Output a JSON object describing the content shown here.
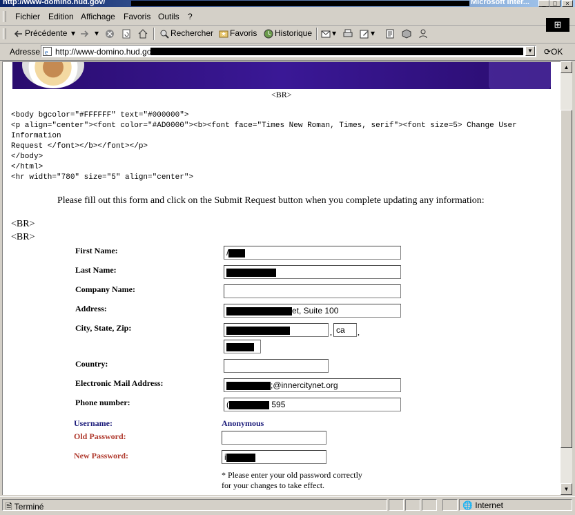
{
  "window": {
    "title_url": "http://www-domino.hud.gov/",
    "app_name": "Microsoft Inter..."
  },
  "menu": [
    {
      "label": "Fichier"
    },
    {
      "label": "Edition"
    },
    {
      "label": "Affichage"
    },
    {
      "label": "Favoris"
    },
    {
      "label": "Outils"
    },
    {
      "label": "?"
    }
  ],
  "toolbar": {
    "back_label": "Précédente",
    "search_label": "Rechercher",
    "favorites_label": "Favoris",
    "history_label": "Historique"
  },
  "address": {
    "label": "Adresse",
    "url": "http://www-domino.hud.gov.",
    "go_label": "OK"
  },
  "page": {
    "br_center": "<BR>",
    "source_lines": [
      "<body bgcolor=\"#FFFFFF\" text=\"#000000\">",
      "<p align=\"center\"><font color=\"#AD0000\"><b><font face=\"Times New Roman, Times, serif\"><font size=5> Change User",
      "Information",
      "Request </font></b></font></p>",
      "</body>",
      "</html>",
      "<hr width=\"780\" size=\"5\" align=\"center\">"
    ],
    "instructions": "Please fill out this form and click on the Submit Request button when you complete updating any information:",
    "br1": "<BR>",
    "br2": "<BR>"
  },
  "form": {
    "first_name_label": "First Name:",
    "first_name_value": "/",
    "last_name_label": "Last Name:",
    "company_label": "Company Name:",
    "company_value": "",
    "address_label": "Address:",
    "address_value": "et, Suite 100",
    "city_label": "City, State, Zip:",
    "state_value": "ca",
    "comma": ",",
    "country_label": "Country:",
    "country_value": "",
    "email_label": "Electronic Mail Address:",
    "email_value": ";@innercitynet.org",
    "phone_label": "Phone number:",
    "phone_prefix": "(",
    "phone_value": "595",
    "username_label": "Username:",
    "username_value": "Anonymous",
    "old_password_label": "Old Password:",
    "old_password_value": "",
    "new_password_label": "New Password:",
    "new_password_prefix": "i",
    "note_line1": "* Please enter your old password correctly",
    "note_line2": "for your changes to take effect."
  },
  "status": {
    "text": "Terminé",
    "zone": "Internet"
  }
}
